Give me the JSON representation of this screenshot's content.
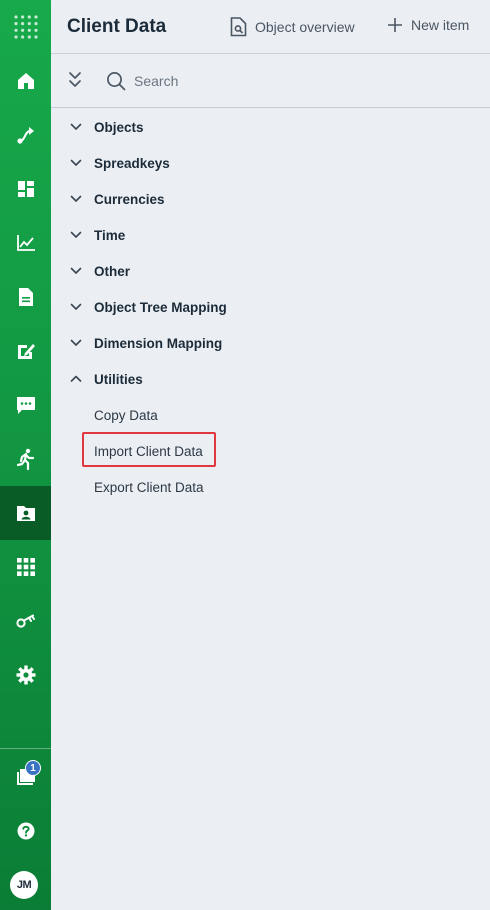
{
  "header": {
    "title": "Client Data",
    "object_overview_label": "Object overview",
    "new_item_label": "New item"
  },
  "search": {
    "placeholder": "Search"
  },
  "tree": {
    "nodes": [
      {
        "label": "Objects",
        "expanded": false
      },
      {
        "label": "Spreadkeys",
        "expanded": false
      },
      {
        "label": "Currencies",
        "expanded": false
      },
      {
        "label": "Time",
        "expanded": false
      },
      {
        "label": "Other",
        "expanded": false
      },
      {
        "label": "Object Tree Mapping",
        "expanded": false
      },
      {
        "label": "Dimension Mapping",
        "expanded": false
      },
      {
        "label": "Utilities",
        "expanded": true
      }
    ],
    "utilities_children": [
      {
        "label": "Copy Data"
      },
      {
        "label": "Import Client Data"
      },
      {
        "label": "Export Client Data"
      }
    ]
  },
  "rail": {
    "items": [
      {
        "icon": "home-icon"
      },
      {
        "icon": "workflow-icon"
      },
      {
        "icon": "dashboard-icon"
      },
      {
        "icon": "chart-icon"
      },
      {
        "icon": "document-icon"
      },
      {
        "icon": "edit-document-icon"
      },
      {
        "icon": "chat-icon"
      },
      {
        "icon": "running-person-icon"
      },
      {
        "icon": "client-data-folder-icon",
        "active": true
      },
      {
        "icon": "apps-grid-icon"
      },
      {
        "icon": "key-icon"
      },
      {
        "icon": "gear-icon"
      }
    ],
    "bottom": {
      "folders_badge": "1",
      "help_icon": "help-icon",
      "avatar_initials": "JM"
    }
  },
  "colors": {
    "rail_green": "#139a44",
    "rail_active": "#0a5c27",
    "background": "#ebeff3",
    "highlight_red": "#e0383e",
    "badge_blue": "#3b73c4"
  }
}
